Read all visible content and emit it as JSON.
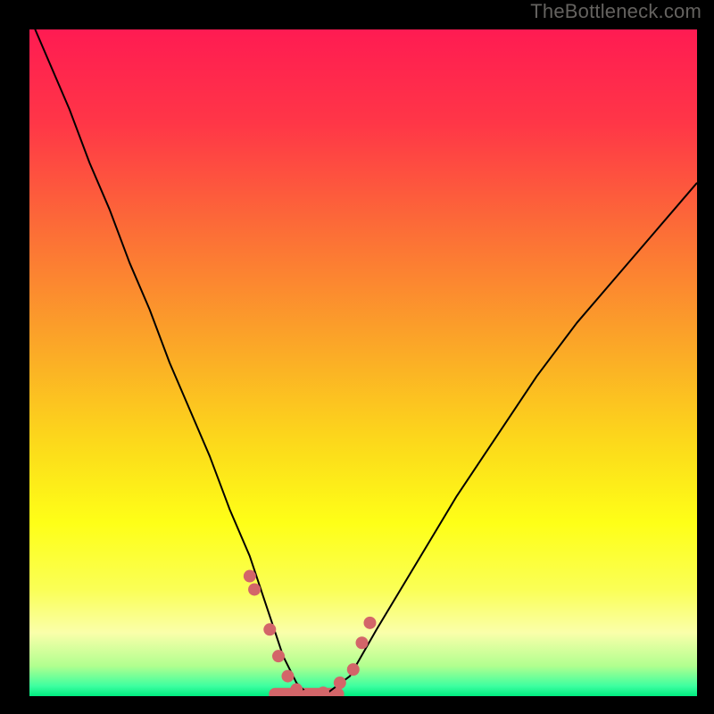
{
  "watermark": "TheBottleneck.com",
  "chart_data": {
    "type": "line",
    "title": "",
    "xlabel": "",
    "ylabel": "",
    "xlim": [
      0,
      100
    ],
    "ylim": [
      0,
      100
    ],
    "background_gradient_stops": [
      {
        "offset": 0,
        "color": "#ff1b52"
      },
      {
        "offset": 0.14,
        "color": "#ff3647"
      },
      {
        "offset": 0.3,
        "color": "#fc6d37"
      },
      {
        "offset": 0.48,
        "color": "#fba927"
      },
      {
        "offset": 0.62,
        "color": "#fcd91b"
      },
      {
        "offset": 0.74,
        "color": "#feff17"
      },
      {
        "offset": 0.84,
        "color": "#faff56"
      },
      {
        "offset": 0.905,
        "color": "#faffaa"
      },
      {
        "offset": 0.955,
        "color": "#b0ff8f"
      },
      {
        "offset": 0.985,
        "color": "#3dffa0"
      },
      {
        "offset": 1.0,
        "color": "#00ec80"
      }
    ],
    "series": [
      {
        "name": "curve",
        "color": "#000000",
        "width": 2,
        "x": [
          0,
          3,
          6,
          9,
          12,
          15,
          18,
          21,
          24,
          27,
          30,
          33,
          36,
          38,
          40,
          42,
          44,
          48,
          52,
          58,
          64,
          70,
          76,
          82,
          88,
          94,
          100
        ],
        "values": [
          102,
          95,
          88,
          80,
          73,
          65,
          58,
          50,
          43,
          36,
          28,
          21,
          12,
          6,
          2,
          0,
          0,
          3,
          10,
          20,
          30,
          39,
          48,
          56,
          63,
          70,
          77
        ]
      },
      {
        "name": "inrange-markers",
        "color": "#d36569",
        "type": "scatter",
        "marker_radius": 7,
        "x": [
          33.0,
          33.7,
          36.0,
          37.3,
          38.7,
          40.0,
          41.3,
          42.7,
          44.0,
          46.5,
          48.5,
          49.8,
          51.0
        ],
        "values": [
          18.0,
          16.0,
          10.0,
          6.0,
          3.0,
          1.0,
          0.0,
          0.0,
          0.5,
          2.0,
          4.0,
          8.0,
          11.0
        ]
      }
    ],
    "bottom_highlight": {
      "color": "#d36569",
      "x_start": 36.8,
      "x_end": 46.2,
      "thickness": 14
    }
  }
}
